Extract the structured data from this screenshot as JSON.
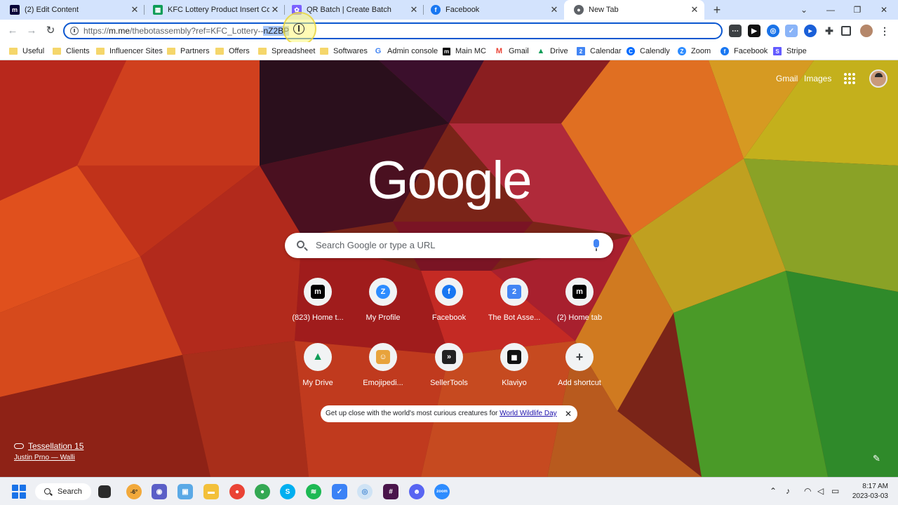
{
  "tabs": [
    {
      "title": "(2) Edit Content",
      "favicon": "miro-icon",
      "color": "#050038"
    },
    {
      "title": "KFC Lottery Product Insert Code",
      "favicon": "sheets-icon",
      "color": "#0f9d58"
    },
    {
      "title": "QR Batch | Create Batch",
      "favicon": "qr-batch-icon",
      "color": "#7b61ff"
    },
    {
      "title": "Facebook",
      "favicon": "facebook-icon",
      "color": "#1877f2"
    },
    {
      "title": "New Tab",
      "favicon": "chrome-icon",
      "color": "#5f6368"
    }
  ],
  "address_bar": {
    "scheme": "https://",
    "host": "m.me",
    "path": "/thebotassembly?ref=KFC_Lottery--",
    "selected": "nZ2BP"
  },
  "bookmarks": [
    {
      "label": "Useful",
      "icon": "folder-icon"
    },
    {
      "label": "Clients",
      "icon": "folder-icon"
    },
    {
      "label": "Influencer Sites",
      "icon": "folder-icon"
    },
    {
      "label": "Partners",
      "icon": "folder-icon"
    },
    {
      "label": "Offers",
      "icon": "folder-icon"
    },
    {
      "label": "Spreadsheet",
      "icon": "folder-icon"
    },
    {
      "label": "Softwares",
      "icon": "folder-icon"
    },
    {
      "label": "Admin console",
      "icon": "google-icon"
    },
    {
      "label": "Main MC",
      "icon": "manychat-icon"
    },
    {
      "label": "Gmail",
      "icon": "gmail-icon"
    },
    {
      "label": "Drive",
      "icon": "drive-icon"
    },
    {
      "label": "Calendar",
      "icon": "calendar-icon"
    },
    {
      "label": "Calendly",
      "icon": "calendly-icon"
    },
    {
      "label": "Zoom",
      "icon": "zoom-icon"
    },
    {
      "label": "Facebook",
      "icon": "facebook-icon"
    },
    {
      "label": "Stripe",
      "icon": "stripe-icon"
    }
  ],
  "header_links": {
    "gmail": "Gmail",
    "images": "Images"
  },
  "logo_text": "Google",
  "search": {
    "placeholder": "Search Google or type a URL"
  },
  "shortcuts": [
    {
      "label": "(823) Home t...",
      "icon": "manychat-icon",
      "color": "#000000"
    },
    {
      "label": "My Profile",
      "icon": "zoom-icon",
      "color": "#2d8cff"
    },
    {
      "label": "Facebook",
      "icon": "facebook-icon",
      "color": "#1877f2"
    },
    {
      "label": "The Bot Asse...",
      "icon": "calendar-icon",
      "color": "#4285f4"
    },
    {
      "label": "(2) Home tab",
      "icon": "manychat-icon",
      "color": "#000000"
    },
    {
      "label": "My Drive",
      "icon": "drive-icon",
      "color": "#0f9d58"
    },
    {
      "label": "Emojipedi...",
      "icon": "emojipedia-icon",
      "color": "#e8a33c"
    },
    {
      "label": "SellerTools",
      "icon": "sellertools-icon",
      "color": "#222222"
    },
    {
      "label": "Klaviyo",
      "icon": "klaviyo-icon",
      "color": "#111111"
    },
    {
      "label": "Add shortcut",
      "icon": "plus-icon",
      "color": "#5f6368"
    }
  ],
  "promo": {
    "text": "Get up close with the world's most curious creatures for ",
    "link": "World Wildlife Day"
  },
  "attribution": {
    "title": "Tessellation 15",
    "author": "Justin Prno — Walli"
  },
  "taskbar": {
    "search_label": "Search",
    "weather": "-6°",
    "time": "8:17 AM",
    "date": "2023-03-03"
  }
}
